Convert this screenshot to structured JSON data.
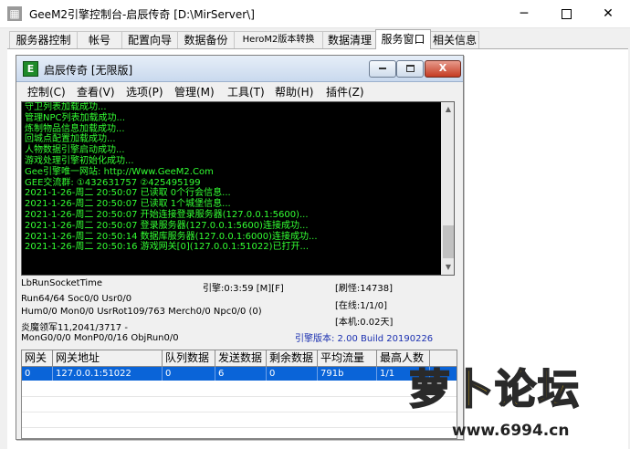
{
  "window": {
    "title": "GeeM2引擎控制台-启辰传奇 [D:\\MirServer\\]",
    "minimize_glyph": "─",
    "close_glyph": "✕"
  },
  "tabs": [
    "服务器控制",
    "帐号",
    "配置向导",
    "数据备份",
    "HeroM2版本转换",
    "数据清理",
    "服务窗口",
    "相关信息"
  ],
  "active_tab": "服务窗口",
  "inner_window": {
    "icon_letter": "E",
    "title": "启辰传奇 [无限版]",
    "close_glyph": "X",
    "menu": [
      "控制(C)",
      "查看(V)",
      "选项(P)",
      "管理(M)",
      "工具(T)",
      "帮助(H)",
      "插件(Z)"
    ]
  },
  "console": {
    "color": "#33ff33",
    "lines": [
      "守卫列表加载成功...",
      "管理NPC列表加载成功...",
      "炼制物品信息加载成功...",
      "回城点配置加载成功...",
      "人物数据引擎启动成功...",
      "游戏处理引擎初始化成功...",
      "Gee引擎唯一网站: http://Www.GeeM2.Com",
      "GEE交流群: ①432631757    ②425495199",
      "2021-1-26-周二 20:50:07 已读取 0个行会信息...",
      "2021-1-26-周二 20:50:07 已读取 1个城堡信息...",
      "2021-1-26-周二 20:50:07 开始连接登录服务器(127.0.0.1:5600)...",
      "2021-1-26-周二 20:50:07 登录服务器(127.0.0.1:5600)连接成功...",
      "2021-1-26-周二 20:50:14 数据库服务器(127.0.0.1:6000)连接成功...",
      "2021-1-26-周二 20:50:16 游戏网关[0](127.0.0.1:51022)已打开..."
    ]
  },
  "stats": {
    "socket_time": "LbRunSocketTime",
    "engine_time": "引擎:0:3:59 [M][F]",
    "refresh": "[刷怪:14738]",
    "run": "Run64/64 Soc0/0 Usr0/0",
    "online": "[在线:1/1/0]",
    "hum": "Hum0/0 Mon0/0 UsrRot109/763 Merch0/0 Npc0/0 (0)",
    "local": "[本机:0.02天]",
    "monster": "炎魔领军11,2041/3717 -",
    "mongen": "MonG0/0/0 MonP0/0/16 ObjRun0/0",
    "version": "引擎版本: 2.00 Build 20190226"
  },
  "gateway_table": {
    "columns": [
      "网关",
      "网关地址",
      "队列数据",
      "发送数据",
      "剩余数据",
      "平均流量",
      "最高人数"
    ],
    "rows": [
      [
        "0",
        "127.0.0.1:51022",
        "0",
        "6",
        "0",
        "791b",
        "1/1"
      ]
    ]
  },
  "watermark": {
    "text": "萝卜论坛",
    "url": "www.6994.cn"
  }
}
